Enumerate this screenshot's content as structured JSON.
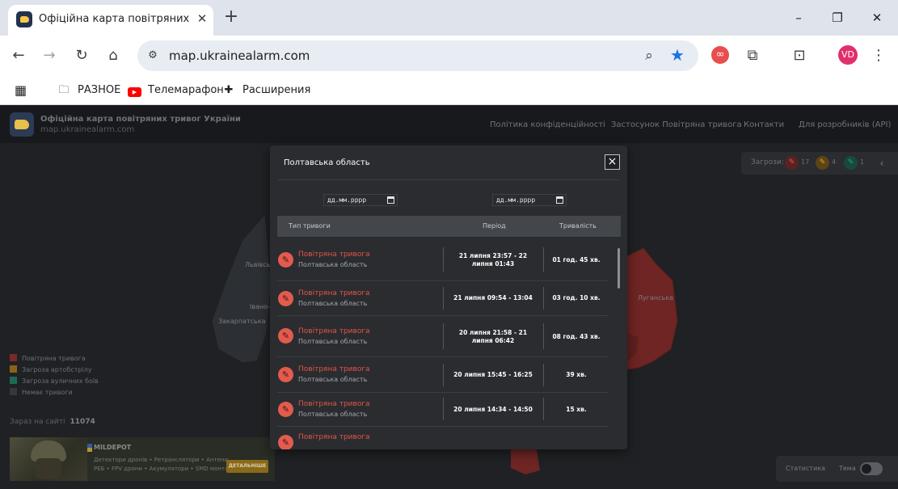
{
  "browser": {
    "tab": {
      "title": "Офіційна карта повітряних тривог України"
    },
    "address": {
      "url": "map.ukrainealarm.com"
    },
    "profile_initials": "VD",
    "bookmarks": [
      {
        "label": "РАЗНОЕ",
        "icon": "folder-icon"
      },
      {
        "label": "Телемарафон",
        "icon": "youtube-icon"
      },
      {
        "label": "Расширения",
        "icon": "puzzle-icon"
      }
    ]
  },
  "site": {
    "title": "Офіційна карта повітряних тривог України",
    "url": "map.ukrainealarm.com",
    "nav": [
      "Політика конфіденційності",
      "Застосунок Повітряна тривога",
      "Контакти",
      "Для розробників (API)"
    ]
  },
  "map": {
    "regions": [
      "Львівська",
      "Івано-Ф",
      "Закарпатська",
      "Луганська"
    ]
  },
  "legend": [
    {
      "label": "Повітряна тривога",
      "color": "#7a2a28"
    },
    {
      "label": "Загроза артобстрілу",
      "color": "#8a6318"
    },
    {
      "label": "Загроза вуличних боїв",
      "color": "#1d6a55"
    },
    {
      "label": "Немає тривоги",
      "color": "#34373c"
    }
  ],
  "online": {
    "label": "Зараз на сайті",
    "count": "11074"
  },
  "threats": {
    "label": "Загрози:",
    "items": [
      {
        "icon": "missile-icon",
        "count": "17",
        "color": "#e35b4e"
      },
      {
        "icon": "artillery-icon",
        "count": "4",
        "color": "#e0a72a"
      },
      {
        "icon": "street-fight-icon",
        "count": "1",
        "color": "#22a07b"
      }
    ]
  },
  "ad": {
    "brand": "MILDEPOT",
    "lines": [
      "Детектори дронів • Ретранслятори • Антени",
      "РЕБ • FPV дрони • Акумулятори • SMD монтаж"
    ],
    "button": "ДЕТАЛЬНІШЕ"
  },
  "footer": {
    "stats": "Статистика",
    "theme": "Тема"
  },
  "modal": {
    "title": "Полтавська область",
    "date_placeholder": "дд.мм.рррр",
    "columns": [
      "Тип тривоги",
      "Період",
      "Тривалість"
    ],
    "rows": [
      {
        "type": "Повітряна тривога",
        "region": "Полтавська область",
        "period": "21 липня 23:57 - 22 липня 01:43",
        "duration": "01 год. 45 хв."
      },
      {
        "type": "Повітряна тривога",
        "region": "Полтавська область",
        "period": "21 липня 09:54 - 13:04",
        "duration": "03 год. 10 хв."
      },
      {
        "type": "Повітряна тривога",
        "region": "Полтавська область",
        "period": "20 липня 21:58 - 21 липня 06:42",
        "duration": "08 год. 43 хв."
      },
      {
        "type": "Повітряна тривога",
        "region": "Полтавська область",
        "period": "20 липня 15:45 - 16:25",
        "duration": "39 хв."
      },
      {
        "type": "Повітряна тривога",
        "region": "Полтавська область",
        "period": "20 липня 14:34 - 14:50",
        "duration": "15 хв."
      },
      {
        "type": "Повітряна тривога",
        "region": "",
        "period": "",
        "duration": ""
      }
    ]
  }
}
